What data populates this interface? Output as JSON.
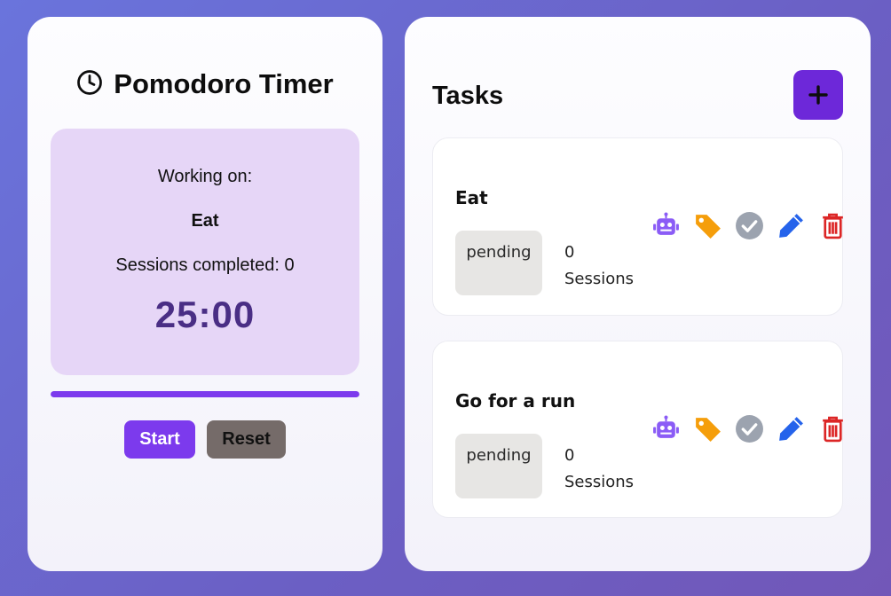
{
  "timer": {
    "title": "Pomodoro Timer",
    "working_on_label": "Working on:",
    "current_task": "Eat",
    "sessions_text": "Sessions completed: 0",
    "time": "25:00",
    "progress": 1.0,
    "start_label": "Start",
    "reset_label": "Reset"
  },
  "tasks": {
    "title": "Tasks",
    "add_icon": "plus-icon",
    "items": [
      {
        "name": "Eat",
        "status": "pending",
        "sessions": "0",
        "sessions_label": "Sessions"
      },
      {
        "name": "Go for a run",
        "status": "pending",
        "sessions": "0",
        "sessions_label": "Sessions"
      }
    ],
    "action_icons": [
      "robot-icon",
      "tag-icon",
      "check-circle-icon",
      "pencil-icon",
      "trash-icon"
    ]
  },
  "colors": {
    "accent": "#7c3aed",
    "add_button": "#6d28d9",
    "timer_box": "#e6d6f7",
    "time_text": "#4a2e85",
    "robot": "#8b5cf6",
    "tag": "#f59e0b",
    "check": "#9ca3af",
    "pencil": "#2563eb",
    "trash": "#dc2626"
  }
}
